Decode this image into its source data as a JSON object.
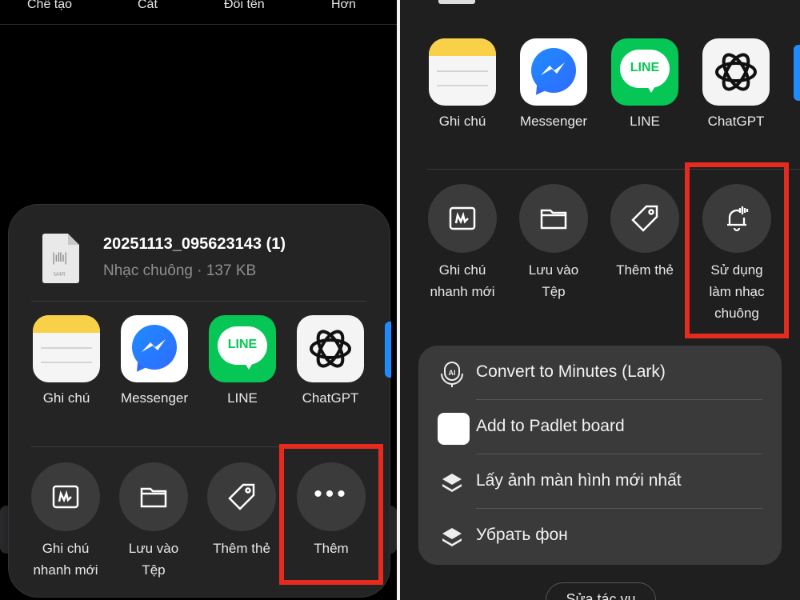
{
  "left_panel": {
    "toolbar": [
      "Chế tạo",
      "Cắt",
      "Đổi tên",
      "Hơn"
    ],
    "file": {
      "name": "20251113_095623143 (1)",
      "meta": "Nhạc chuông · 137 KB",
      "ext": "M4R",
      "icon": "audio-file-icon"
    },
    "apps": [
      {
        "label": "Ghi chú",
        "icon": "notes-icon"
      },
      {
        "label": "Messenger",
        "icon": "messenger-icon"
      },
      {
        "label": "LINE",
        "icon": "line-icon"
      },
      {
        "label": "ChatGPT",
        "icon": "chatgpt-icon"
      }
    ],
    "actions": [
      {
        "line1": "Ghi chú",
        "line2": "nhanh mới",
        "icon": "quick-note-icon"
      },
      {
        "line1": "Lưu vào",
        "line2": "Tệp",
        "icon": "folder-icon"
      },
      {
        "line1": "Thêm thẻ",
        "line2": "",
        "icon": "tag-icon"
      },
      {
        "line1": "Thêm",
        "line2": "",
        "icon": "more-icon"
      }
    ]
  },
  "right_panel": {
    "apps": [
      {
        "label": "Ghi chú",
        "icon": "notes-icon"
      },
      {
        "label": "Messenger",
        "icon": "messenger-icon"
      },
      {
        "label": "LINE",
        "icon": "line-icon"
      },
      {
        "label": "ChatGPT",
        "icon": "chatgpt-icon"
      }
    ],
    "actions": [
      {
        "line1": "Ghi chú",
        "line2": "nhanh mới",
        "line3": "",
        "icon": "quick-note-icon"
      },
      {
        "line1": "Lưu vào",
        "line2": "Tệp",
        "line3": "",
        "icon": "folder-icon"
      },
      {
        "line1": "Thêm thẻ",
        "line2": "",
        "line3": "",
        "icon": "tag-icon"
      },
      {
        "line1": "Sử dụng",
        "line2": "làm nhạc",
        "line3": "chuông",
        "icon": "ringtone-bell-icon"
      }
    ],
    "list": [
      {
        "label": "Convert to Minutes (Lark)",
        "icon": "ai-microphone-icon"
      },
      {
        "label": "Add to Padlet board",
        "icon": "padlet-icon"
      },
      {
        "label": "Lấy ảnh màn hình mới nhất",
        "icon": "shortcuts-layers-icon"
      },
      {
        "label": "Убрать фон",
        "icon": "shortcuts-layers-icon"
      }
    ],
    "edit_button": "Sửa tác vụ"
  },
  "colors": {
    "highlight": "#e62a1d",
    "sheet_bg": "#242424",
    "line_green": "#06c755",
    "messenger_blue": "#1e8cff",
    "notes_yellow": "#f8d148"
  }
}
